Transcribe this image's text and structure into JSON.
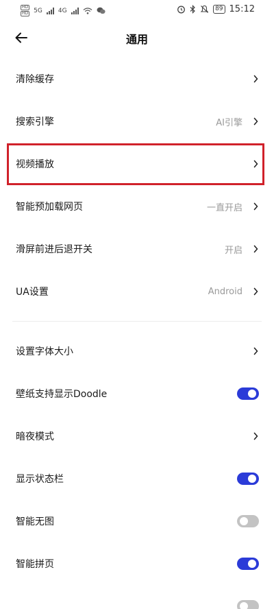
{
  "status_bar": {
    "hd1": "HD",
    "hd2": "HD",
    "net1": "5G",
    "net2": "4G",
    "battery": "89",
    "time": "15:12"
  },
  "header": {
    "title": "通用"
  },
  "items_group1": [
    {
      "label": "清除缓存",
      "value": "",
      "control": "chevron"
    },
    {
      "label": "搜索引擎",
      "value": "AI引擎",
      "control": "chevron"
    },
    {
      "label": "视频播放",
      "value": "",
      "control": "chevron",
      "highlighted": true
    },
    {
      "label": "智能预加载网页",
      "value": "一直开启",
      "control": "chevron"
    },
    {
      "label": "滑屏前进后退开关",
      "value": "开启",
      "control": "chevron"
    },
    {
      "label": "UA设置",
      "value": "Android",
      "control": "chevron"
    }
  ],
  "items_group2": [
    {
      "label": "设置字体大小",
      "value": "",
      "control": "chevron"
    },
    {
      "label": "壁纸支持显示Doodle",
      "control": "toggle",
      "on": true
    },
    {
      "label": "暗夜模式",
      "value": "",
      "control": "chevron"
    },
    {
      "label": "显示状态栏",
      "control": "toggle",
      "on": true
    },
    {
      "label": "智能无图",
      "control": "toggle",
      "on": false
    },
    {
      "label": "智能拼页",
      "control": "toggle",
      "on": true
    }
  ],
  "colors": {
    "toggle_on": "#2b3bd8",
    "toggle_off": "#c3c3c3",
    "highlight": "#d0212a"
  }
}
